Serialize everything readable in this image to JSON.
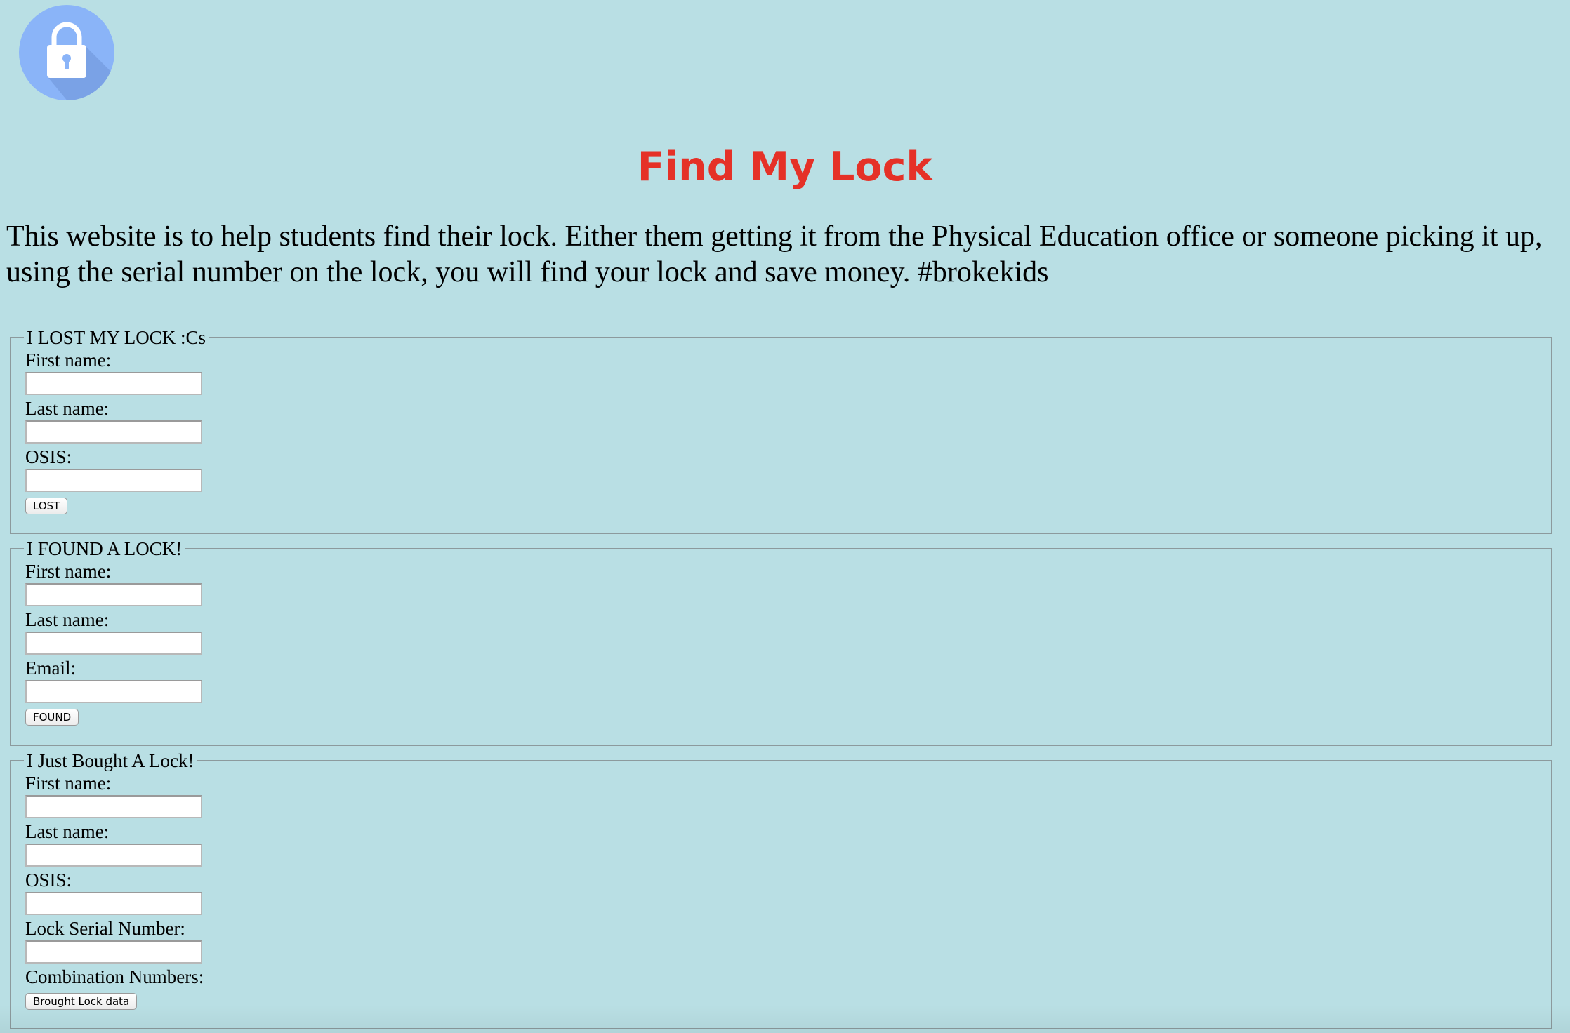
{
  "page": {
    "title": "Find My Lock",
    "intro": "This website is to help students find their lock. Either them getting it from the Physical Education office or someone picking it up, using the serial number on the lock, you will find your lock and save money. #brokekids",
    "logo_icon": "lock-icon",
    "colors": {
      "background": "#b9dfe4",
      "title": "#e53127",
      "logo_circle": "#8ab4f8",
      "logo_shadow": "#7aa2e6"
    }
  },
  "lost_form": {
    "legend": "I LOST MY LOCK :Cs",
    "first_name_label": "First name:",
    "last_name_label": "Last name:",
    "osis_label": "OSIS:",
    "first_name_value": "",
    "last_name_value": "",
    "osis_value": "",
    "submit_label": "LOST"
  },
  "found_form": {
    "legend": "I FOUND A LOCK!",
    "first_name_label": "First name:",
    "last_name_label": "Last name:",
    "email_label": "Email:",
    "first_name_value": "",
    "last_name_value": "",
    "email_value": "",
    "submit_label": "FOUND"
  },
  "bought_form": {
    "legend": "I Just Bought A Lock!",
    "first_name_label": "First name:",
    "last_name_label": "Last name:",
    "osis_label": "OSIS:",
    "serial_label": "Lock Serial Number:",
    "combination_label": "Combination Numbers:",
    "first_name_value": "",
    "last_name_value": "",
    "osis_value": "",
    "serial_value": "",
    "submit_label": "Brought Lock data"
  }
}
